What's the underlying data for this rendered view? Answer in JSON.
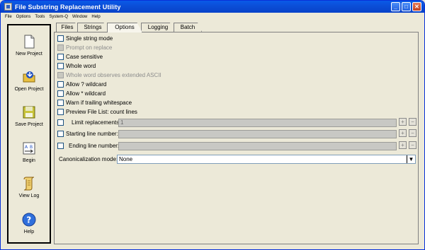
{
  "window": {
    "title": "File Substring Replacement Utility",
    "controls": {
      "minimize": "_",
      "maximize": "□",
      "close": "✕"
    }
  },
  "menu": [
    "File",
    "Options",
    "Tools",
    "System-Q",
    "Window",
    "Help"
  ],
  "sidebar": {
    "items": [
      {
        "label": "New Project",
        "icon": "new-document-icon"
      },
      {
        "label": "Open Project",
        "icon": "open-folder-icon"
      },
      {
        "label": "Save Project",
        "icon": "save-disk-icon"
      },
      {
        "label": "Begin",
        "icon": "begin-run-icon"
      },
      {
        "label": "View Log",
        "icon": "scroll-log-icon"
      },
      {
        "label": "Help",
        "icon": "help-question-icon"
      }
    ]
  },
  "tabs": [
    {
      "label": "Files"
    },
    {
      "label": "Strings"
    },
    {
      "label": "Options"
    },
    {
      "label": "Logging"
    },
    {
      "label": "Batch"
    }
  ],
  "active_tab": "Options",
  "options": {
    "checkboxes": [
      {
        "label": "Single string mode",
        "disabled": false
      },
      {
        "label": "Prompt on replace",
        "disabled": true
      },
      {
        "label": "Case sensitive",
        "disabled": false
      },
      {
        "label": "Whole word",
        "disabled": false
      },
      {
        "label": "Whole word observes extended ASCII",
        "disabled": true
      },
      {
        "label": "Allow ? wildcard",
        "disabled": false
      },
      {
        "label": "Allow * wildcard",
        "disabled": false
      },
      {
        "label": "Warn if trailing whitespace",
        "disabled": false
      },
      {
        "label": "Preview File List: count lines",
        "disabled": false
      }
    ],
    "fields": [
      {
        "label": "Limit replacements:",
        "value": "1"
      },
      {
        "label": "Starting line number:",
        "value": ""
      },
      {
        "label": "Ending line number:",
        "value": ""
      }
    ],
    "spinner": {
      "plus": "+",
      "minus": "−"
    },
    "canonicalization": {
      "label": "Canonicalization mode:",
      "value": "None",
      "arrow": "▼"
    }
  },
  "colors": {
    "title_blue": "#0b4fd8",
    "panel_bg": "#ece9d8"
  }
}
